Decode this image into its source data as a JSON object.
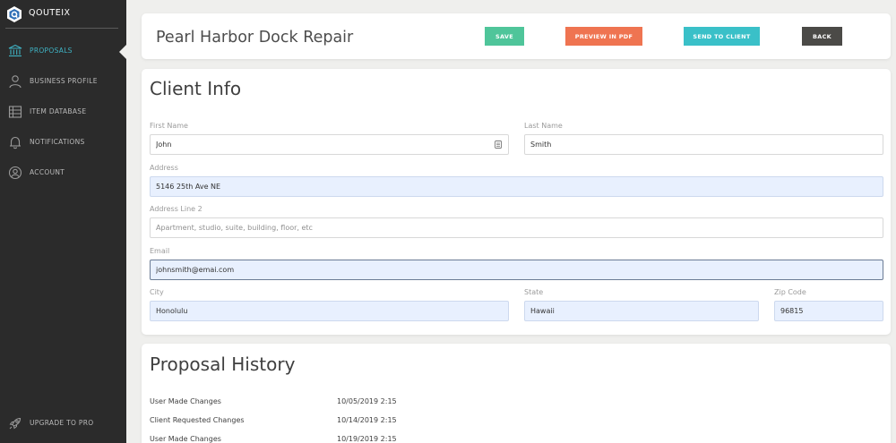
{
  "brand": {
    "name": "QOUTEIX"
  },
  "sidebar": {
    "items": [
      {
        "label": "PROPOSALS",
        "icon": "bank-icon"
      },
      {
        "label": "BUSINESS PROFILE",
        "icon": "user-icon"
      },
      {
        "label": "ITEM DATABASE",
        "icon": "database-icon"
      },
      {
        "label": "NOTIFICATIONS",
        "icon": "bell-icon"
      },
      {
        "label": "ACCOUNT",
        "icon": "account-icon"
      }
    ],
    "upgrade": {
      "label": "UPGRADE TO PRO",
      "icon": "rocket-icon"
    }
  },
  "header": {
    "title": "Pearl Harbor Dock Repair",
    "save_label": "SAVE",
    "pdf_label": "PREVIEW IN PDF",
    "send_label": "SEND TO CLIENT",
    "back_label": "BACK"
  },
  "client_info": {
    "title": "Client Info",
    "first_name": {
      "label": "First Name",
      "value": "John"
    },
    "last_name": {
      "label": "Last Name",
      "value": "Smith"
    },
    "address": {
      "label": "Address",
      "value": "5146 25th Ave NE"
    },
    "address2": {
      "label": "Address Line 2",
      "value": "",
      "placeholder": "Apartment, studio, suite, building, floor, etc"
    },
    "email": {
      "label": "Email",
      "value": "johnsmith@emai.com"
    },
    "city": {
      "label": "City",
      "value": "Honolulu"
    },
    "state": {
      "label": "State",
      "value": "Hawaii"
    },
    "zip": {
      "label": "Zip Code",
      "value": "96815"
    }
  },
  "history": {
    "title": "Proposal History",
    "rows": [
      {
        "event": "User Made Changes",
        "date": "10/05/2019 2:15"
      },
      {
        "event": "Client Requested Changes",
        "date": "10/14/2019 2:15"
      },
      {
        "event": "User Made Changes",
        "date": "10/19/2019 2:15"
      }
    ]
  },
  "colors": {
    "sidebar_bg": "#2b2b2b",
    "accent": "#3fb3c4",
    "save": "#4fc59a",
    "pdf": "#ef7451",
    "send": "#3ac0c8",
    "back": "#4b4a47"
  }
}
